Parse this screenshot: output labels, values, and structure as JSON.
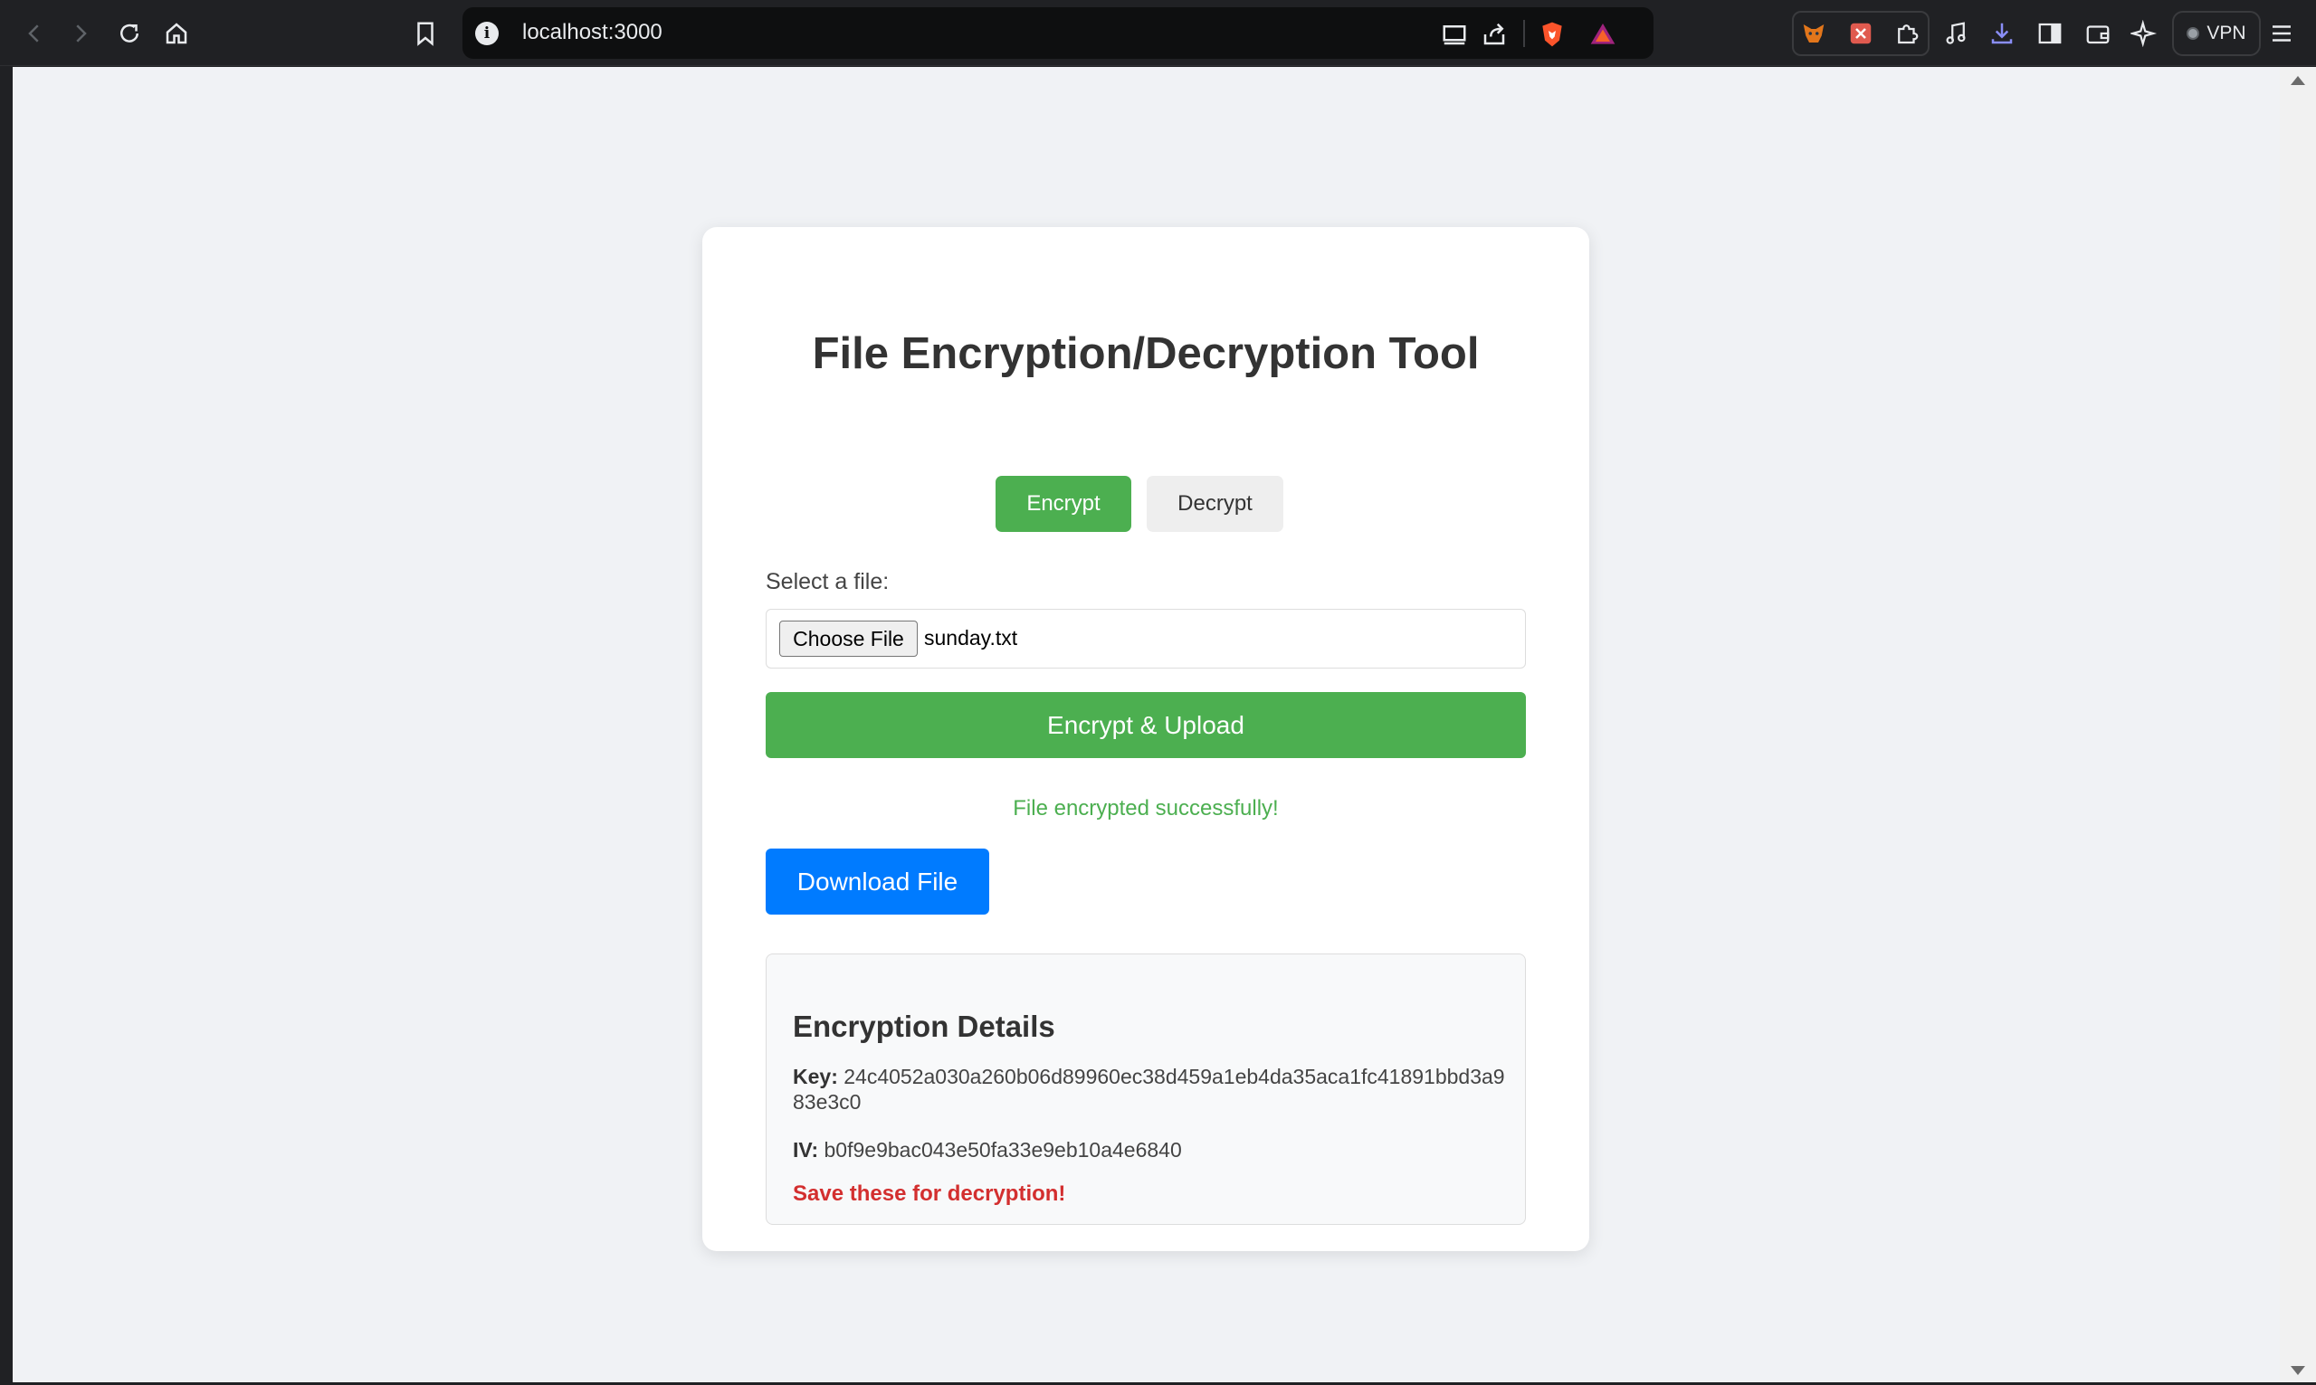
{
  "browser": {
    "url": "localhost:3000",
    "vpn_label": "VPN",
    "icons": [
      "back-icon",
      "forward-icon",
      "reload-icon",
      "home-icon",
      "bookmark-icon",
      "info-icon",
      "cast-icon",
      "share-icon",
      "brave-shield-icon",
      "brave-rewards-icon",
      "metamask-icon",
      "extension-icon",
      "puzzle-icon",
      "music-icon",
      "download-icon",
      "sidebar-icon",
      "wallet-icon",
      "leo-ai-icon",
      "menu-icon"
    ]
  },
  "app": {
    "title": "File Encryption/Decryption Tool",
    "modes": {
      "encrypt": "Encrypt",
      "decrypt": "Decrypt",
      "active": "Encrypt"
    },
    "file_label": "Select a file:",
    "choose_button": "Choose File",
    "file_name": "sunday.txt",
    "submit_button": "Encrypt & Upload",
    "status": "File encrypted successfully!",
    "download_button": "Download File",
    "details": {
      "title": "Encryption Details",
      "key_label": "Key:",
      "key_value": "24c4052a030a260b06d89960ec38d459a1eb4da35aca1fc41891bbd3a983e3c0",
      "iv_label": "IV:",
      "iv_value": "b0f9e9bac043e50fa33e9eb10a4e6840",
      "warning": "Save these for decryption!"
    }
  },
  "colors": {
    "accent_green": "#4caf50",
    "download_blue": "#007bff",
    "warning_red": "#d32f2f",
    "page_bg": "#f0f2f5",
    "chrome_bg": "#202124"
  }
}
